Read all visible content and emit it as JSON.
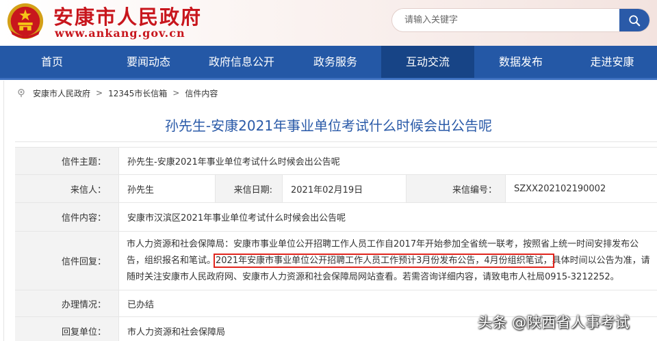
{
  "header": {
    "site_name": "安康市人民政府",
    "site_domain": "www.ankang.gov.cn"
  },
  "search": {
    "placeholder": "请输入关键字"
  },
  "nav": {
    "items": [
      {
        "label": "首页"
      },
      {
        "label": "要闻动态"
      },
      {
        "label": "政府信息公开"
      },
      {
        "label": "政务服务"
      },
      {
        "label": "互动交流",
        "active": true
      },
      {
        "label": "数据发布"
      },
      {
        "label": "走进安康"
      }
    ]
  },
  "breadcrumb": {
    "items": [
      "安康市人民政府",
      "12345市长信箱",
      "信件内容"
    ],
    "separator": ">"
  },
  "letter": {
    "title": "孙先生-安康2021年事业单位考试什么时候会出公告呢",
    "subject_label": "信件主题：",
    "subject": "孙先生-安康2021年事业单位考试什么时候会出公告呢",
    "sender_label": "来信人：",
    "sender": "孙先生",
    "date_label": "来信日期:",
    "date": "2021年02月19日",
    "number_label": "来信编号：",
    "number": "SZXX202102190002",
    "content_label": "信件内容：",
    "content": "安康市汉滨区2021年事业单位考试什么时候会出公告呢",
    "reply_label": "信件回复：",
    "reply_part1": "市人力资源和社会保障局：安康市事业单位公开招聘工作人员工作自2017年开始参加全省统一联考，按照省上统一时间安排发布公告，组织报名和笔试。",
    "reply_highlight": "2021年安康市事业单位公开招聘工作人员工作预计3月份发布公告，4月份组织笔试，",
    "reply_part2": "具体时间以公告为准，请随时关注安康市人民政府网、安康市人力资源和社会保障局网站查看。若需咨询详细内容，请致电市人社局0915-3212252。",
    "status_label": "办理情况：",
    "status": "已办结",
    "unit_label": "回复单位：",
    "unit": "市人力资源和社会保障局"
  },
  "watermark": "头条 @陕西省人事考试",
  "colors": {
    "brand_red": "#c8161d",
    "nav_blue": "#2458a6",
    "nav_active": "#174486",
    "title_blue": "#2a5aa8",
    "highlight_red": "#e0241c"
  },
  "icons": {
    "emblem": "national-emblem-icon",
    "search": "search-icon",
    "home": "home-icon"
  }
}
